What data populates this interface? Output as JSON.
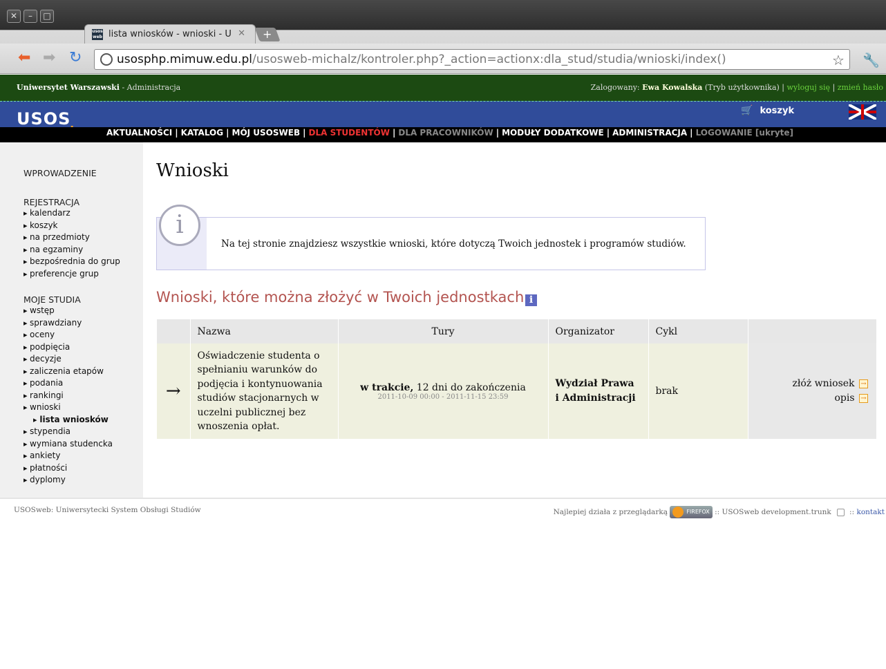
{
  "browser": {
    "tab_title": "lista wniosków - wnioski - U",
    "tab_favicon_text": "usos web",
    "url_host": "usosphp.mimuw.edu.pl",
    "url_path": "/usosweb-michalz/kontroler.php?_action=actionx:dla_stud/studia/wnioski/index()"
  },
  "topbar": {
    "university": "Uniwersytet Warszawski",
    "section": " - Administracja",
    "logged_label": "Zalogowany: ",
    "user_name": "Ewa Kowalska",
    "user_mode": " (Tryb użytkownika) | ",
    "logout": "wyloguj się",
    "sep": " | ",
    "change_password": "zmień hasło"
  },
  "header": {
    "logo_main": "USOS",
    "logo_sub": "web",
    "cart": "koszyk"
  },
  "menu": {
    "items": [
      "AKTUALNOŚCI",
      "KATALOG",
      "MÓJ USOSWEB",
      "DLA STUDENTÓW",
      "DLA PRACOWNIKÓW",
      "MODUŁY DODATKOWE",
      "ADMINISTRACJA",
      "LOGOWANIE"
    ],
    "hidden_note": "[ukryte]",
    "sep": "|"
  },
  "sidebar": {
    "intro": "WPROWADZENIE",
    "registration": "REJESTRACJA",
    "registration_items": [
      "kalendarz",
      "koszyk",
      "na przedmioty",
      "na egzaminy",
      "bezpośrednia do grup",
      "preferencje grup"
    ],
    "studies": "MOJE STUDIA",
    "studies_items": [
      "wstęp",
      "sprawdziany",
      "oceny",
      "podpięcia",
      "decyzje",
      "zaliczenia etapów",
      "podania",
      "rankingi",
      "wnioski"
    ],
    "current_item": "lista wniosków",
    "studies_items_after": [
      "stypendia",
      "wymiana studencka",
      "ankiety",
      "płatności",
      "dyplomy"
    ]
  },
  "main": {
    "title": "Wnioski",
    "info_icon": "i",
    "info_text": "Na tej stronie znajdziesz wszystkie wnioski, które dotyczą Twoich jednostek i programów studiów.",
    "section_title": "Wnioski, które można złożyć w Twoich jednostkach.",
    "section_icon": "i"
  },
  "table": {
    "headers": [
      "",
      "Nazwa",
      "Tury",
      "Organizator",
      "Cykl",
      ""
    ],
    "row": {
      "arrow": "→",
      "name": "Oświadczenie studenta o spełnianiu warunków do podjęcia i kontynuowania studiów stacjonarnych w uczelni publicznej bez wnoszenia opłat.",
      "status_bold": "w trakcie,",
      "status_rest": " 12 dni do zakończenia",
      "dates": "2011-10-09 00:00 - 2011-11-15 23:59",
      "organizer": "Wydział Prawa i Administracji",
      "cycle": "brak",
      "action_submit": "złóż wniosek",
      "action_desc": "opis"
    }
  },
  "footer": {
    "left": "USOSweb: Uniwersytecki System Obsługi Studiów",
    "best_with": "Najlepiej działa z przeglądarką",
    "firefox": "FIREFOX",
    "version": " :: USOSweb development.trunk",
    "sep": " :: ",
    "contact": "kontakt"
  }
}
